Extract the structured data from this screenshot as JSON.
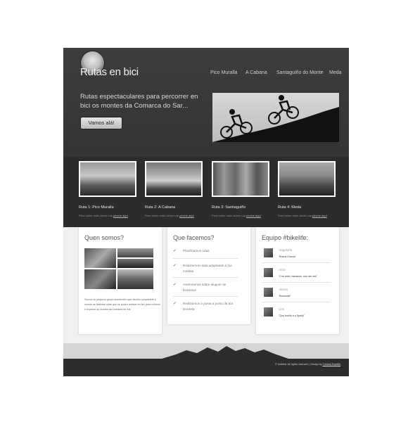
{
  "header": {
    "logo_text": "Rutas en bici",
    "nav": [
      "Pico Muralla",
      "A Cabana",
      "Santaguiño do Monte",
      "Meda"
    ],
    "tagline": "Rutas espectaculares para percorrer en bici os montes da Comarca do Sar...",
    "cta_label": "Vamos alá!"
  },
  "routes": [
    {
      "title": "Ruta 1: Pico Muralla",
      "sub": "Para saber máis desta ruta",
      "link": "pinche aquí"
    },
    {
      "title": "Ruta 2: A Cabana",
      "sub": "Para saber máis desta ruta",
      "link": "pinche aquí"
    },
    {
      "title": "Ruta 3: Santiaguiño",
      "sub": "Para saber máis desta ruta",
      "link": "pinche aquí"
    },
    {
      "title": "Ruta 4: Meda",
      "sub": "Para saber máis desta ruta",
      "link": "pinche aquí"
    }
  ],
  "about": {
    "title": "Quen somos?",
    "text": "Somos un pequeno grupo aventureiro que decidiu compartirte ó mundo as distintas rutas que se poden realizar en bici para coñecer e explorar os montes da Comarca do Sar."
  },
  "services": {
    "title": "Que facemos?",
    "items": [
      "Planificamos rutas",
      "Realizamos rutas adaptadas á túa medida",
      "Asesoramos sobre aluguer de bicicletas",
      "Realizamos a posta a punto da túa bicicleta"
    ]
  },
  "team": {
    "title": "Equipo #bikelife:",
    "members": [
      {
        "name": "Angelaño",
        "quote": "\"Bosos Crosos\""
      },
      {
        "name": "Aroa",
        "quote": "\"Con estio, baixando, non me ves\""
      },
      {
        "name": "Álvaro",
        "quote": "\"Bouroulle\""
      },
      {
        "name": "Cris",
        "quote": "\"Que bonito é o Spelly\""
      }
    ]
  },
  "footer": {
    "text": "© Untitled. All rights reserved.  |  Design by",
    "link": "Cristina Espiells"
  }
}
